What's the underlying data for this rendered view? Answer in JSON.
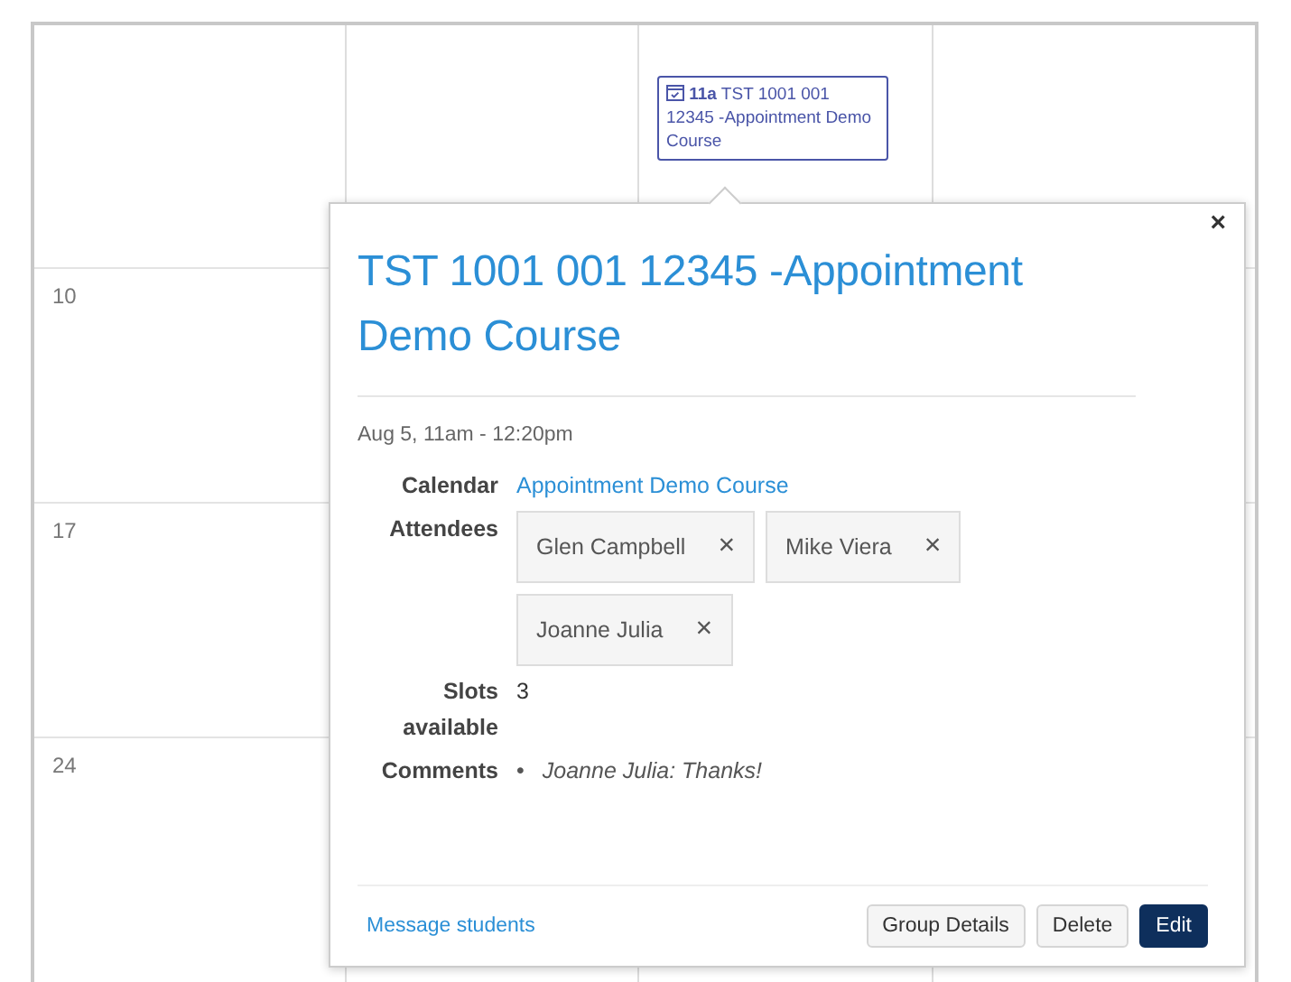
{
  "calendar": {
    "event": {
      "time": "11a",
      "title": "TST 1001 001 12345 -Appointment Demo Course"
    },
    "week_labels": [
      "10",
      "17",
      "24"
    ]
  },
  "popover": {
    "close": "×",
    "title": "TST 1001 001 12345 -Appointment Demo Course",
    "datetime": "Aug 5, 11am - 12:20pm",
    "details": [
      {
        "kind": "link",
        "label": "Calendar",
        "value": "Appointment Demo Course"
      },
      {
        "kind": "tags",
        "label": "Attendees",
        "items": [
          {
            "name": "Glen Campbell",
            "remove": "×"
          },
          {
            "name": "Mike Viera",
            "remove": "×"
          },
          {
            "name": "Joanne Julia",
            "remove": "×"
          }
        ]
      },
      {
        "kind": "text",
        "label": "Slots available",
        "value": "3"
      },
      {
        "kind": "list",
        "label": "Comments",
        "bullet": "•",
        "items": [
          "Joanne Julia: Thanks!"
        ]
      }
    ],
    "footer_link": "Message students",
    "buttons": [
      {
        "label": "Group Details",
        "kind": "secondary"
      },
      {
        "label": "Delete",
        "kind": "secondary"
      },
      {
        "label": "Edit",
        "kind": "primary"
      }
    ]
  }
}
